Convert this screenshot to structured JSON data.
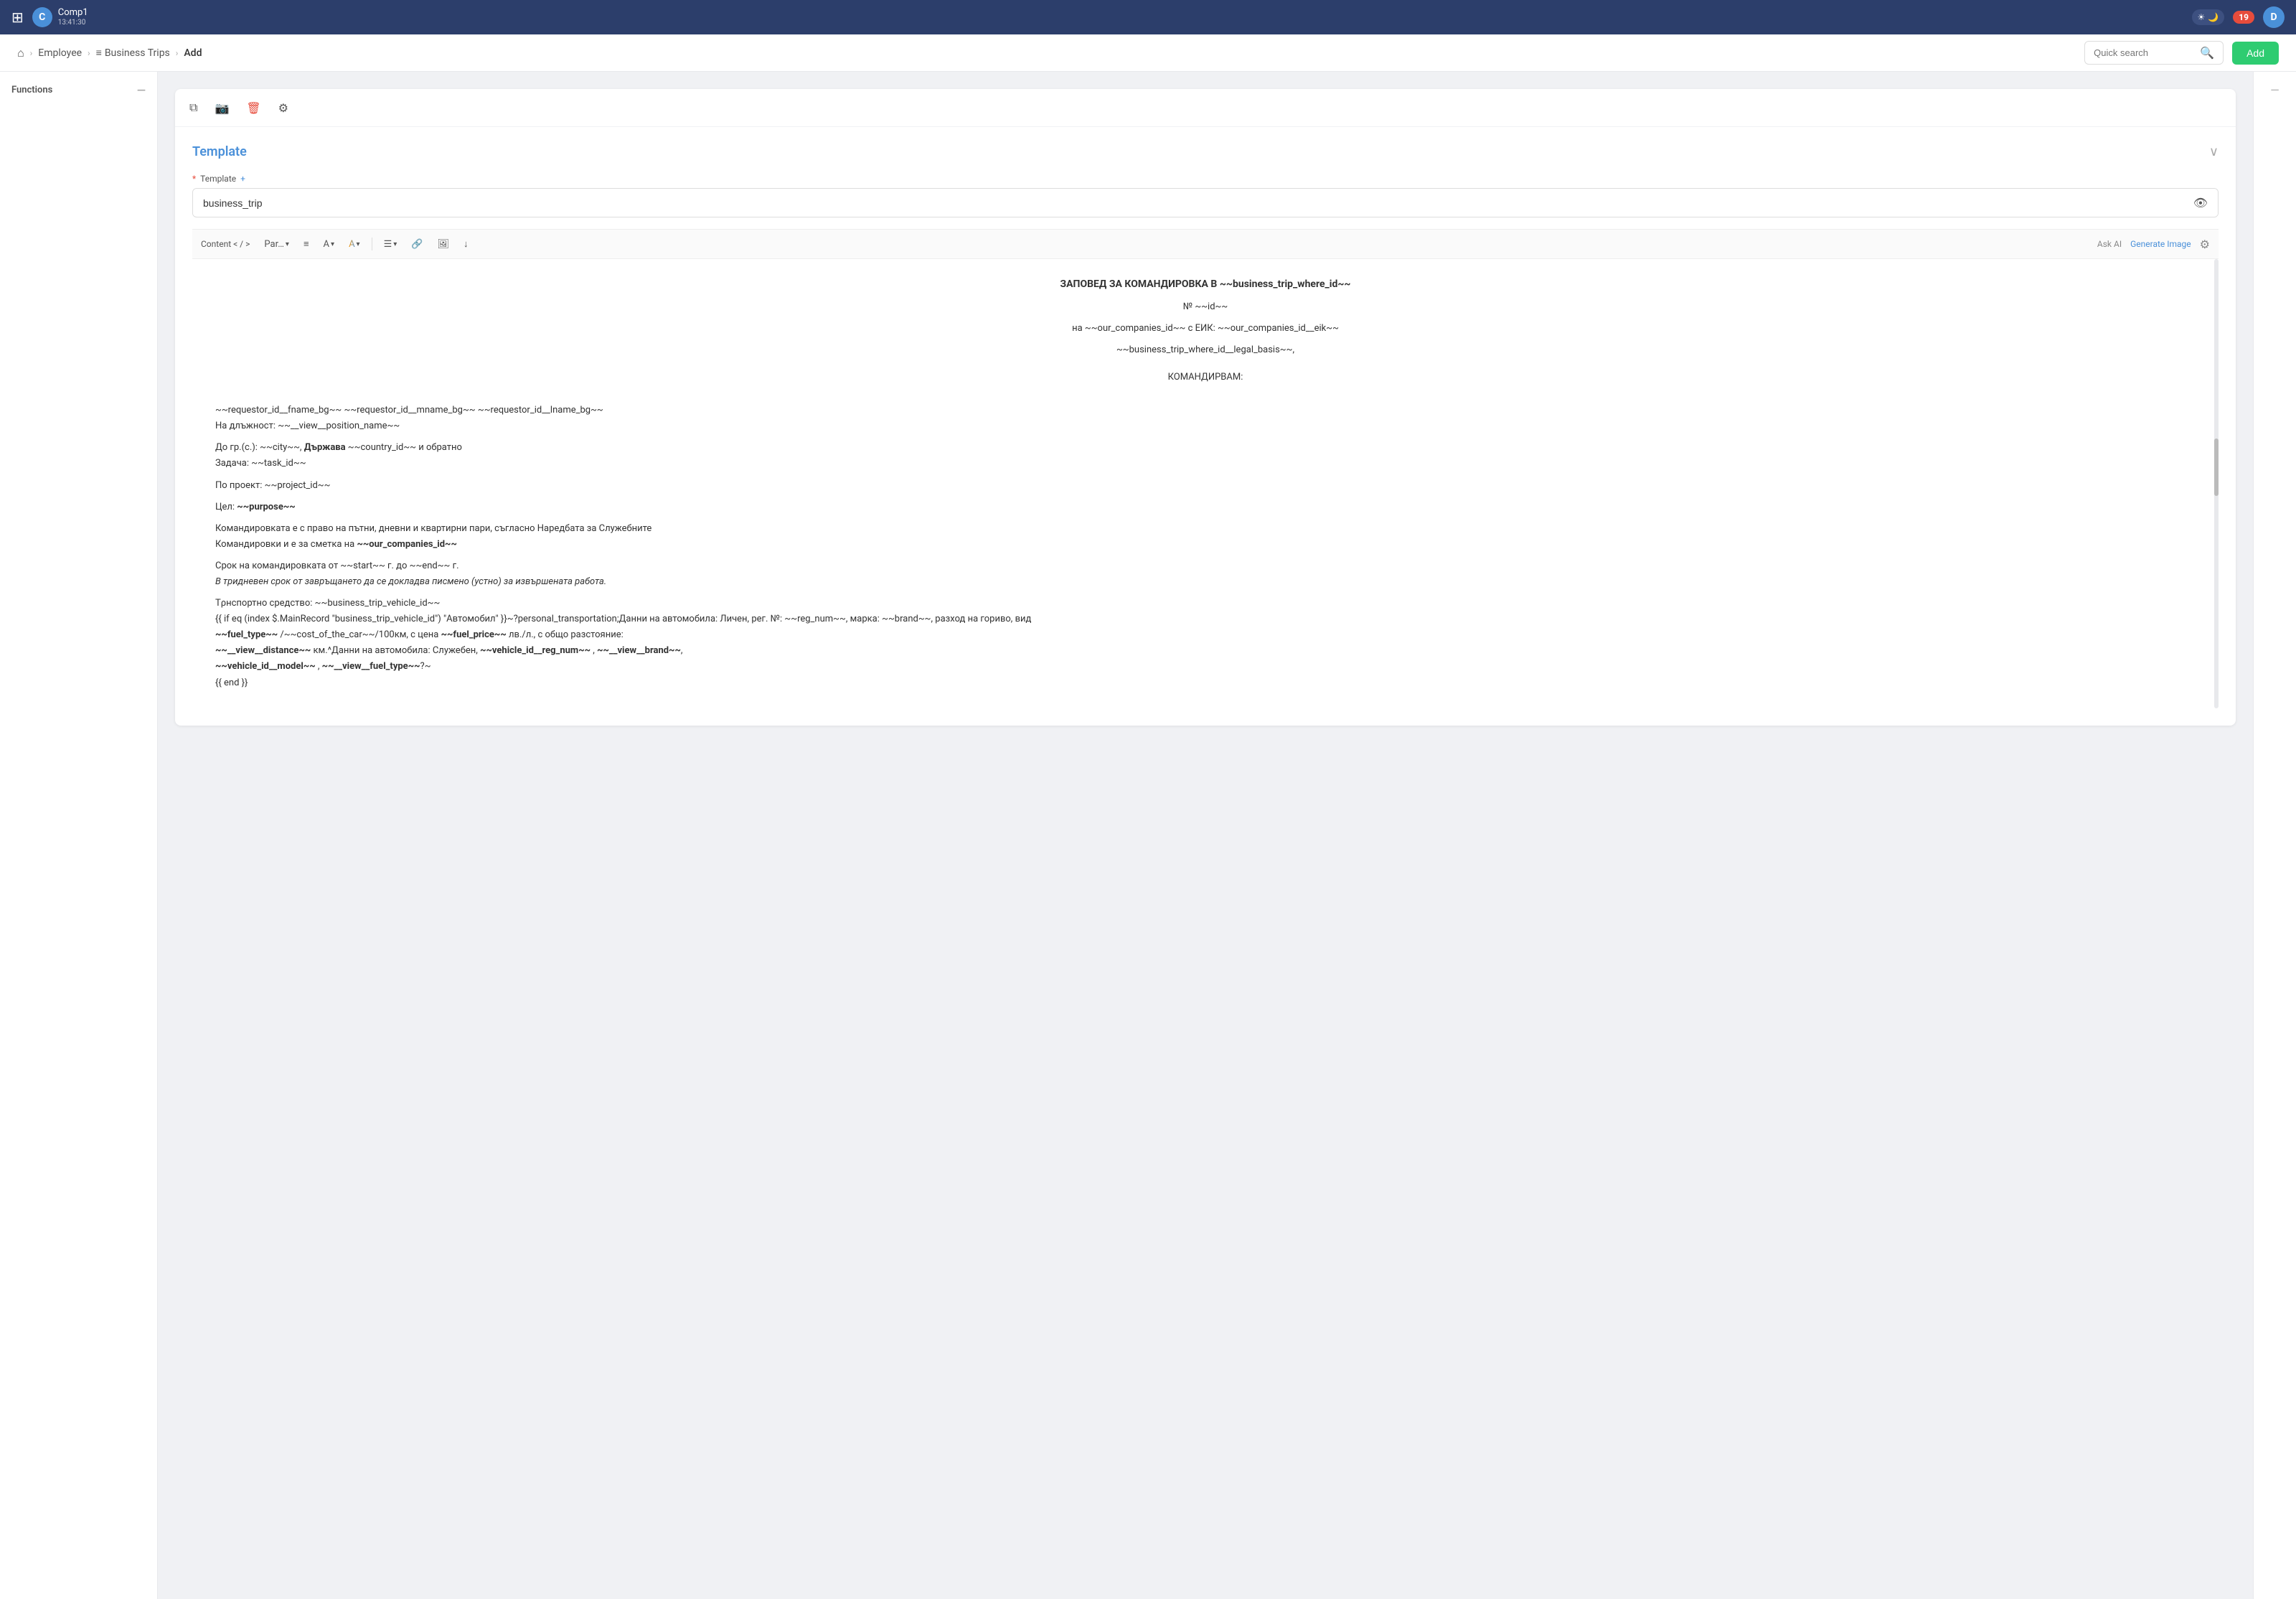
{
  "navbar": {
    "logo_text": "Comp1",
    "logo_sub": "13:41:30",
    "logo_initial": "C",
    "theme_light": "☀",
    "theme_dark": "🌙",
    "notifications": "19",
    "user_initial": "D"
  },
  "breadcrumb": {
    "home_icon": "⌂",
    "items": [
      {
        "label": "Employee",
        "active": false
      },
      {
        "label": "Business Trips",
        "active": false
      },
      {
        "label": "Add",
        "active": true
      }
    ],
    "search_placeholder": "Quick search",
    "add_label": "Add"
  },
  "sidebar": {
    "title": "Functions",
    "collapse_icon": "—"
  },
  "right_panel": {
    "collapse_icon": "—"
  },
  "toolbar": {
    "icons": [
      "copy",
      "camera",
      "delete",
      "settings"
    ]
  },
  "template": {
    "title": "Template",
    "collapse_icon": "∨",
    "field_label": "* Template",
    "field_add": "+",
    "field_value": "business_trip",
    "eye_icon": "👁",
    "content_label": "Content < / >",
    "ask_ai": "Ask AI",
    "generate_image": "Generate Image",
    "editor_toolbar": {
      "paragraph_btn": "Par…",
      "align_btn": "≡",
      "font_btn": "A",
      "highlight_btn": "A",
      "list_btn": "☰",
      "link_btn": "🔗",
      "image_btn": "🖼",
      "arrow_btn": "↓"
    },
    "content_lines": [
      "ЗАПОВЕД ЗА КОМАНДИРОВКА В ~~business_trip_where_id~~",
      "№ ~~id~~",
      "на ~~our_companies_id~~ с ЕИК: ~~our_companies_id__eik~~",
      "~~business_trip_where_id__legal_basis~~,",
      "",
      "КОМАНДИРВАМ:",
      "",
      "~~requestor_id__fname_bg~~ ~~requestor_id__mname_bg~~ ~~requestor_id__lname_bg~~",
      "На длъжност: ~~__view__position_name~~",
      "",
      "До гр.(с.): ~~city~~, Държава ~~country_id~~ и обратно",
      "Задача: ~~task_id~~",
      "По проект: ~~project_id~~",
      "Цел: ~~purpose~~",
      "",
      "Командировката е с право на пътни, дневни и квартирни пари, съгласно Наредбата за Служебните Командировки и е за сметка на ~~our_companies_id~~",
      "",
      "Срок на командировката от ~~start~~ г. до ~~end~~ г.",
      "В тридневен срок от завръщането да се докладва писмено (устно) за извършената работа.",
      "",
      "Тρнспортно средство: ~~business_trip_vehicle_id~~",
      "{{ if eq (index $.MainRecord \"business_trip_vehicle_id\") \"Автомобил\" }}~?personal_transportation;Данни на автомобила:  Личен, рег. №: ~~reg_num~~, марка: ~~brand~~, разход на гориво, вид",
      "~~fuel_type~~ /~~cost_of_the_car~~/100км, с цена ~~fuel_price~~ лв./л., с общо разстояние:",
      "~~__view__distance~~ км.^Данни на автомобила: Служебен, ~~vehicle_id__reg_num~~ , ~~__view__brand~~,",
      "~~vehicle_id__model~~ , ~~__view__fuel_type~~?~",
      "{{ end }}"
    ]
  }
}
